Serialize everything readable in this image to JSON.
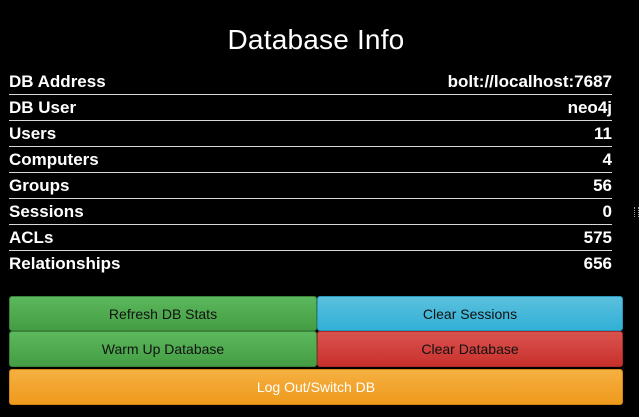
{
  "title": "Database Info",
  "stats": [
    {
      "label": "DB Address",
      "value": "bolt://localhost:7687"
    },
    {
      "label": "DB User",
      "value": "neo4j"
    },
    {
      "label": "Users",
      "value": "11"
    },
    {
      "label": "Computers",
      "value": "4"
    },
    {
      "label": "Groups",
      "value": "56"
    },
    {
      "label": "Sessions",
      "value": "0"
    },
    {
      "label": "ACLs",
      "value": "575"
    },
    {
      "label": "Relationships",
      "value": "656"
    }
  ],
  "buttons": {
    "refresh": "Refresh DB Stats",
    "clear_sessions": "Clear Sessions",
    "warm_up": "Warm Up Database",
    "clear_database": "Clear Database",
    "logout": "Log Out/Switch DB"
  },
  "colors": {
    "background": "#000000",
    "green": "#5cb85c",
    "blue": "#5bc0de",
    "red": "#d9534f",
    "orange": "#f0ad4e"
  }
}
